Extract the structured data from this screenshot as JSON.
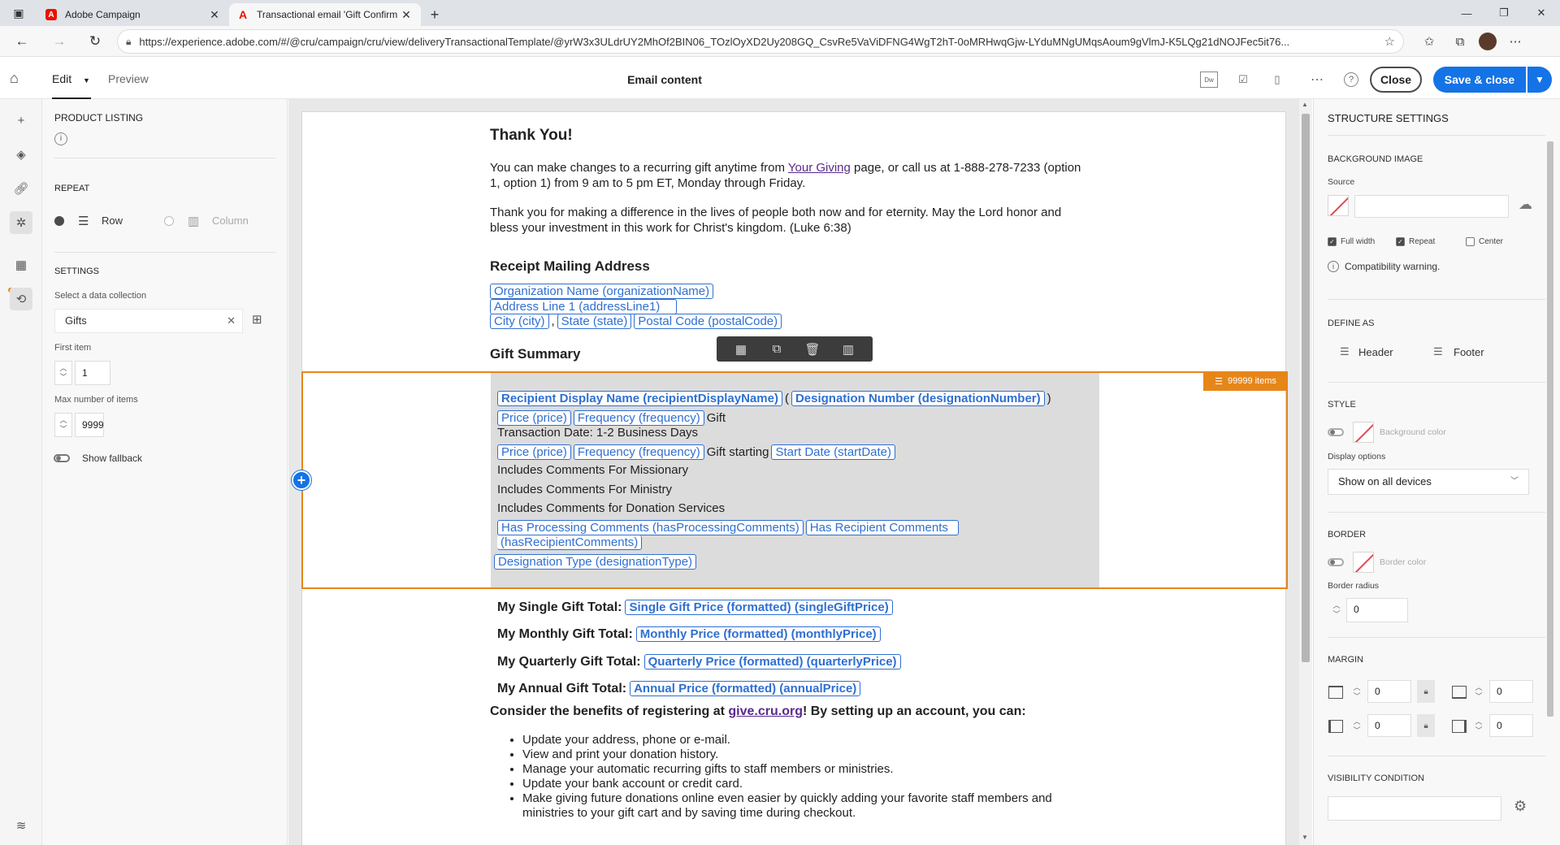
{
  "browser": {
    "tabs": [
      {
        "title": "Adobe Campaign",
        "active": false
      },
      {
        "title": "Transactional email 'Gift Confirm",
        "active": true
      }
    ],
    "url": "https://experience.adobe.com/#/@cru/campaign/cru/view/deliveryTransactionalTemplate/@yrW3x3ULdrUY2MhOf2BIN06_TOzlOyXD2Uy208GQ_CsvRe5VaViDFNG4WgT2hT-0oMRHwqGjw-LYduMNgUMqsAoum9gVlmJ-K5LQg21dNOJFec5it76..."
  },
  "toolbar": {
    "edit_tab": "Edit",
    "preview_tab": "Preview",
    "title": "Email content",
    "close_label": "Close",
    "save_label": "Save & close"
  },
  "left_panel": {
    "section_title": "PRODUCT LISTING",
    "repeat_title": "REPEAT",
    "row_label": "Row",
    "column_label": "Column",
    "settings_title": "SETTINGS",
    "collection_label": "Select a data collection",
    "collection_value": "Gifts",
    "first_item_label": "First item",
    "first_item_value": "1",
    "max_items_label": "Max number of items",
    "max_items_value": "9999",
    "fallback_label": "Show fallback"
  },
  "email": {
    "thank_you": "Thank You!",
    "para1_a": "You can make changes to a recurring gift anytime from",
    "para1_link": "Your Giving",
    "para1_b": "page, or call us at 1-888-278-7233 (option 1, option 1) from 9 am to 5 pm ET, Monday through Friday.",
    "para2": "Thank you for making a difference in the lives of people both now and for eternity. May the Lord honor and bless your investment in this work for Christ's kingdom. (Luke 6:38)",
    "receipt_heading": "Receipt Mailing Address",
    "org_token": "Organization Name (organizationName)",
    "address_token": "Address Line 1 (addressLine1)",
    "city_token": "City (city)",
    "state_token": "State (state)",
    "postal_token": "Postal Code (postalCode)",
    "comma": ",",
    "gift_summary": "Gift Summary",
    "badge": "99999 items",
    "recipient_token": "Recipient Display Name (recipientDisplayName)",
    "open_paren": "(",
    "close_paren": ")",
    "designation_token": "Designation Number (designationNumber)",
    "price_token": "Price (price)",
    "frequency_token": "Frequency (frequency)",
    "gift_word": "Gift",
    "transaction_date": "Transaction Date: 1-2 Business Days",
    "gift_starting": "Gift starting",
    "start_date_token": "Start Date (startDate)",
    "comments_missionary": "Includes Comments For Missionary",
    "comments_ministry": "Includes Comments For Ministry",
    "comments_donation": "Includes Comments for Donation Services",
    "has_processing_token": "Has Processing Comments (hasProcessingComments)",
    "has_recipient_token_a": "Has Recipient Comments",
    "has_recipient_token_b": "(hasRecipientComments)",
    "designation_type_token": "Designation Type (designationType)",
    "single_label": "My Single Gift Total:",
    "single_token": "Single Gift Price (formatted) (singleGiftPrice)",
    "monthly_label": "My Monthly Gift Total:",
    "monthly_token": "Monthly Price (formatted) (monthlyPrice)",
    "quarterly_label": "My Quarterly Gift Total:",
    "quarterly_token": "Quarterly Price (formatted) (quarterlyPrice)",
    "annual_label": "My Annual Gift Total:",
    "annual_token": "Annual Price (formatted) (annualPrice)",
    "consider_a": "Consider the benefits of registering at",
    "consider_link": "give.cru.org",
    "consider_b": "! By setting up an account, you can:",
    "bullets": [
      "Update your address, phone or e-mail.",
      "View and print your donation history.",
      "Manage your automatic recurring gifts to staff members or ministries.",
      "Update your bank account or credit card.",
      "Make giving future donations online even easier by quickly adding your favorite staff members and ministries to your gift cart and by saving time during checkout."
    ]
  },
  "right_panel": {
    "title": "STRUCTURE SETTINGS",
    "bg_image": "BACKGROUND IMAGE",
    "source": "Source",
    "full_width": "Full width",
    "repeat": "Repeat",
    "center": "Center",
    "compat": "Compatibility warning.",
    "define_as": "DEFINE AS",
    "header": "Header",
    "footer": "Footer",
    "style": "STYLE",
    "bg_color": "Background color",
    "display_options": "Display options",
    "display_value": "Show on all devices",
    "border": "BORDER",
    "border_color": "Border color",
    "border_radius": "Border radius",
    "border_radius_value": "0",
    "margin": "MARGIN",
    "margin_top": "0",
    "margin_bottom": "0",
    "margin_left": "0",
    "margin_right": "0",
    "visibility": "VISIBILITY CONDITION"
  },
  "colors": {
    "accent": "#1473e6",
    "selection": "#e68619",
    "token": "#2f6fd1"
  }
}
